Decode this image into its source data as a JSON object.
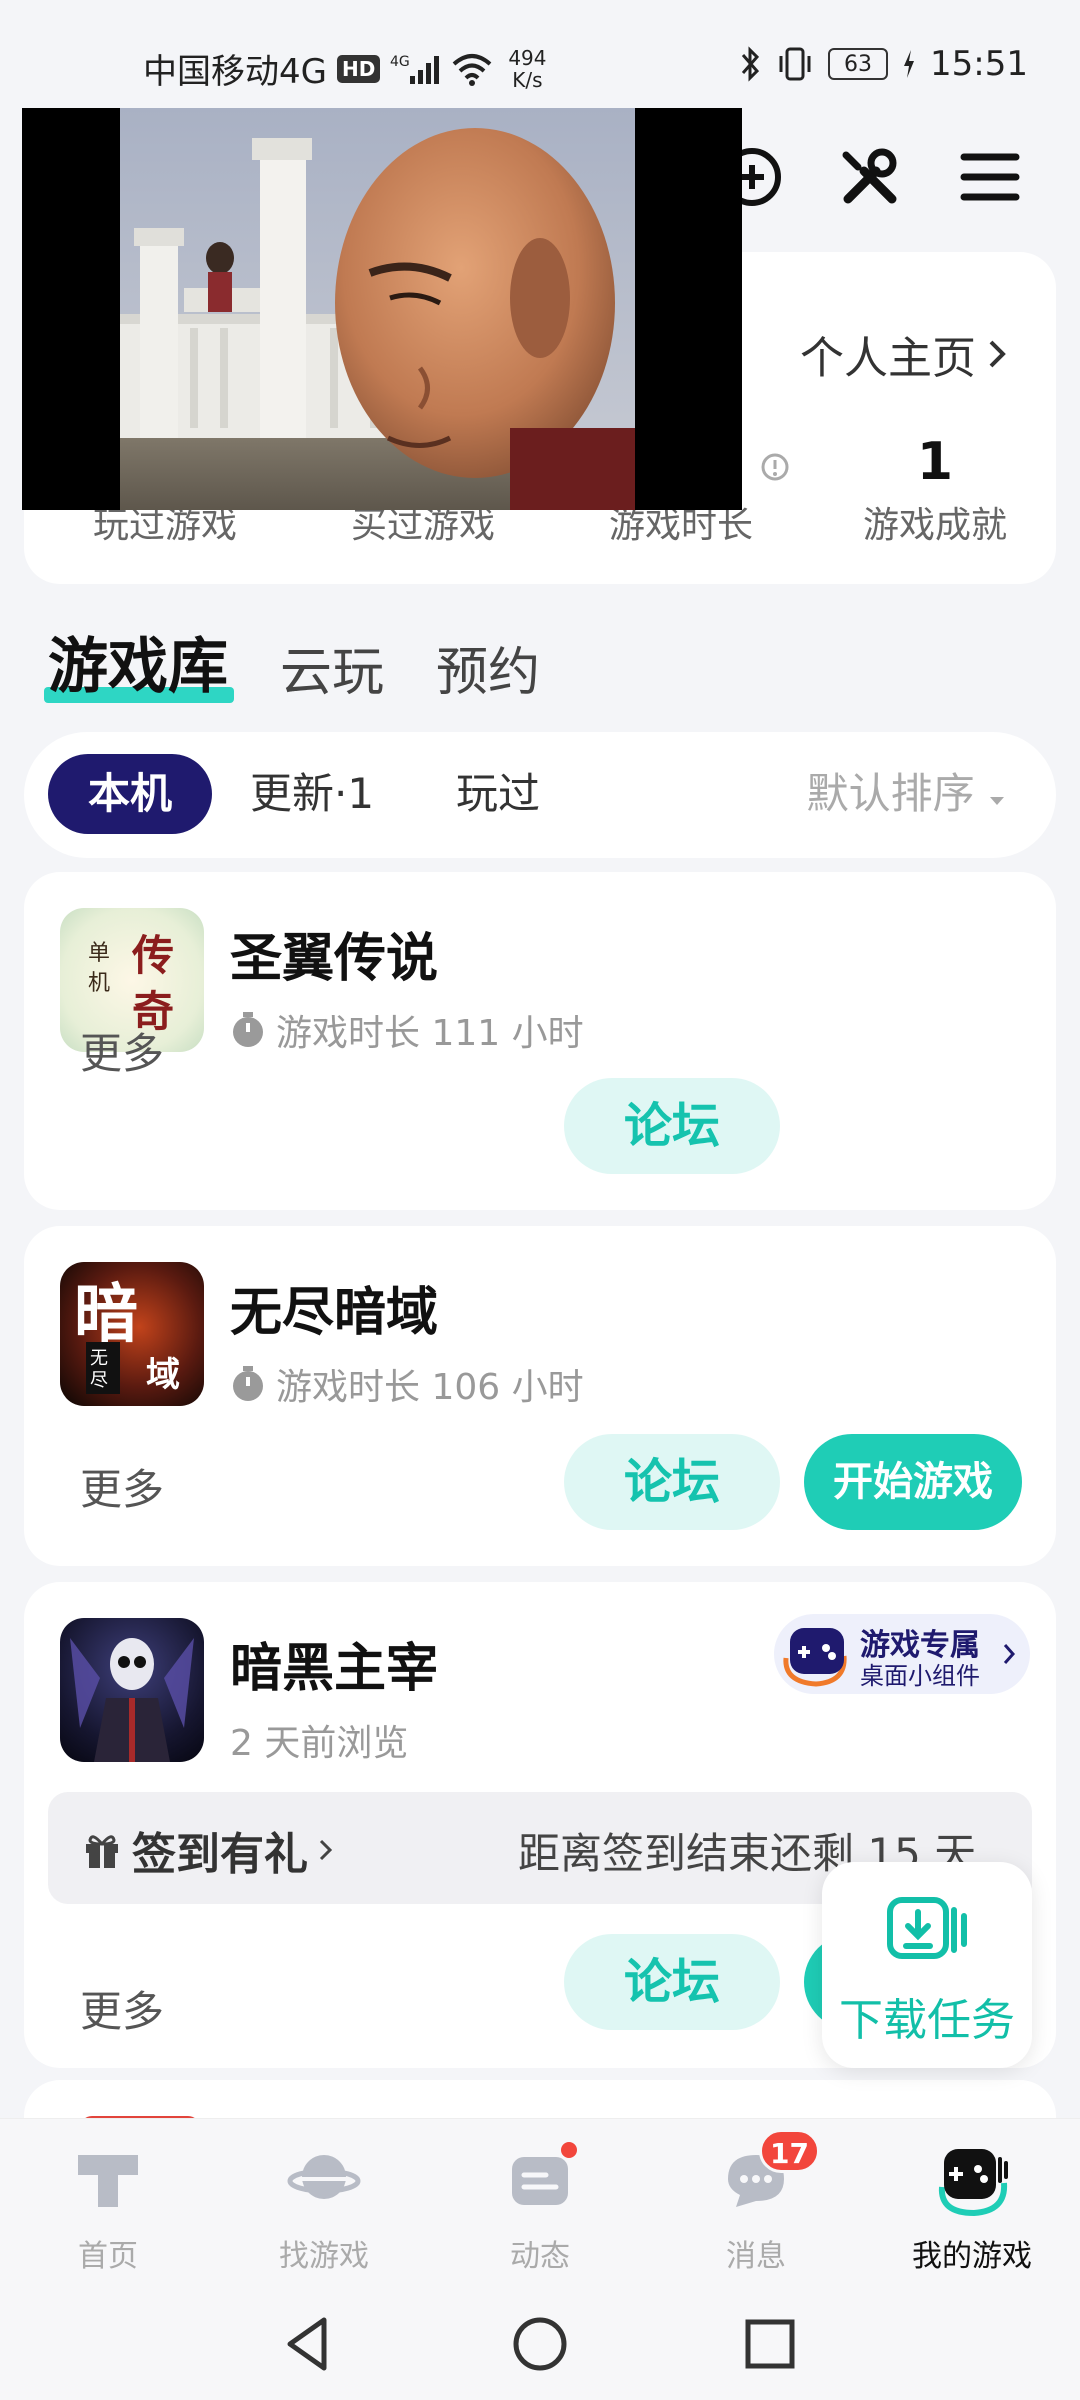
{
  "status_bar": {
    "carrier": "中国移动4G",
    "hd": "HD",
    "net_speed_value": "494",
    "net_speed_unit": "K/s",
    "battery": "63",
    "time": "15:51"
  },
  "stats": {
    "profile_link": "个人主页",
    "items": [
      {
        "value": "",
        "label": "玩过游戏"
      },
      {
        "value": "",
        "label": "买过游戏"
      },
      {
        "value": "",
        "label": "游戏时长"
      },
      {
        "value": "1",
        "label": "游戏成就"
      }
    ]
  },
  "lib_tabs": [
    "游戏库",
    "云玩",
    "预约"
  ],
  "filters": {
    "chips": [
      "本机",
      "更新·1",
      "玩过"
    ],
    "sort": "默认排序"
  },
  "games": [
    {
      "title": "圣翼传说",
      "subtitle": "游戏时长 111 小时",
      "more": "更多",
      "forum": "论坛"
    },
    {
      "title": "无尽暗域",
      "subtitle": "游戏时长 106 小时",
      "more": "更多",
      "forum": "论坛",
      "play": "开始游戏"
    },
    {
      "title": "暗黑主宰",
      "subtitle": "2 天前浏览",
      "more": "更多",
      "forum": "论坛",
      "widget_title": "游戏专属",
      "widget_sub": "桌面小组件",
      "sign_in": "签到有礼",
      "sign_countdown": "距离签到结束还剩 15 天"
    }
  ],
  "download_task": "下载任务",
  "bottom_nav": [
    {
      "label": "首页"
    },
    {
      "label": "找游戏"
    },
    {
      "label": "动态"
    },
    {
      "label": "消息",
      "badge": "17"
    },
    {
      "label": "我的游戏"
    }
  ],
  "icon_art": {
    "icon1_chars": [
      "传",
      "奇",
      "单",
      "机"
    ],
    "icon2_chars": [
      "暗",
      "域",
      "无",
      "尽"
    ]
  },
  "colors": {
    "accent": "#1fcdb6",
    "accent_light": "#dff7f4",
    "brand_dark": "#1f1a6e",
    "badge_red": "#f2463c"
  }
}
